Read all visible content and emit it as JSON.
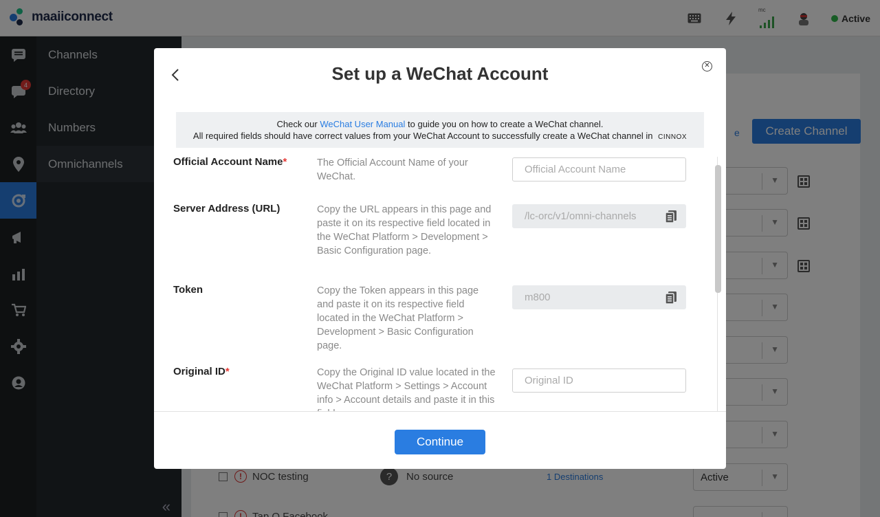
{
  "app": {
    "logo_text": "maaiiconnect"
  },
  "topbar": {
    "status_label": "Active",
    "signal_label": "mc"
  },
  "rail": {
    "messages_badge": "4"
  },
  "subnav": {
    "items": [
      {
        "label": "Channels"
      },
      {
        "label": "Directory"
      },
      {
        "label": "Numbers"
      },
      {
        "label": "Omnichannels"
      }
    ]
  },
  "background": {
    "create_channel_label": "Create Channel",
    "rows": [
      {
        "name": "NOC testing",
        "source": "No source",
        "destinations": "1 Destinations",
        "status": "Active"
      },
      {
        "name": "Tap Q Facebook"
      }
    ]
  },
  "modal": {
    "title": "Set up a WeChat Account",
    "notice": {
      "prefix": "Check our",
      "link": "WeChat User Manual",
      "suffix": "to guide you on how to create a WeChat channel.",
      "line2": "All required fields should have correct values from your WeChat Account to successfully create a WeChat channel in",
      "brand": "CINNOX"
    },
    "fields": [
      {
        "label": "Official Account Name",
        "required": "*",
        "description": "The Official Account Name of your WeChat.",
        "placeholder": "Official Account Name",
        "value": ""
      },
      {
        "label": "Server Address (URL)",
        "required": "",
        "description": "Copy the URL appears in this page and paste it on its respective field located in the WeChat Platform > Development > Basic Configuration page.",
        "placeholder": "",
        "value": "/lc-orc/v1/omni-channels"
      },
      {
        "label": "Token",
        "required": "",
        "description": "Copy the Token appears in this page and paste it on its respective field located in the WeChat Platform > Development > Basic Configuration page.",
        "placeholder": "",
        "value": "m800"
      },
      {
        "label": "Original ID",
        "required": "*",
        "description": "Copy the Original ID value located in the WeChat Platform > Settings > Account info > Account details and paste it in this field.",
        "placeholder": "Original ID",
        "value": ""
      }
    ],
    "continue_label": "Continue"
  },
  "colors": {
    "accent": "#2a7de1",
    "required": "#e53935",
    "status_active": "#2fb84a"
  }
}
